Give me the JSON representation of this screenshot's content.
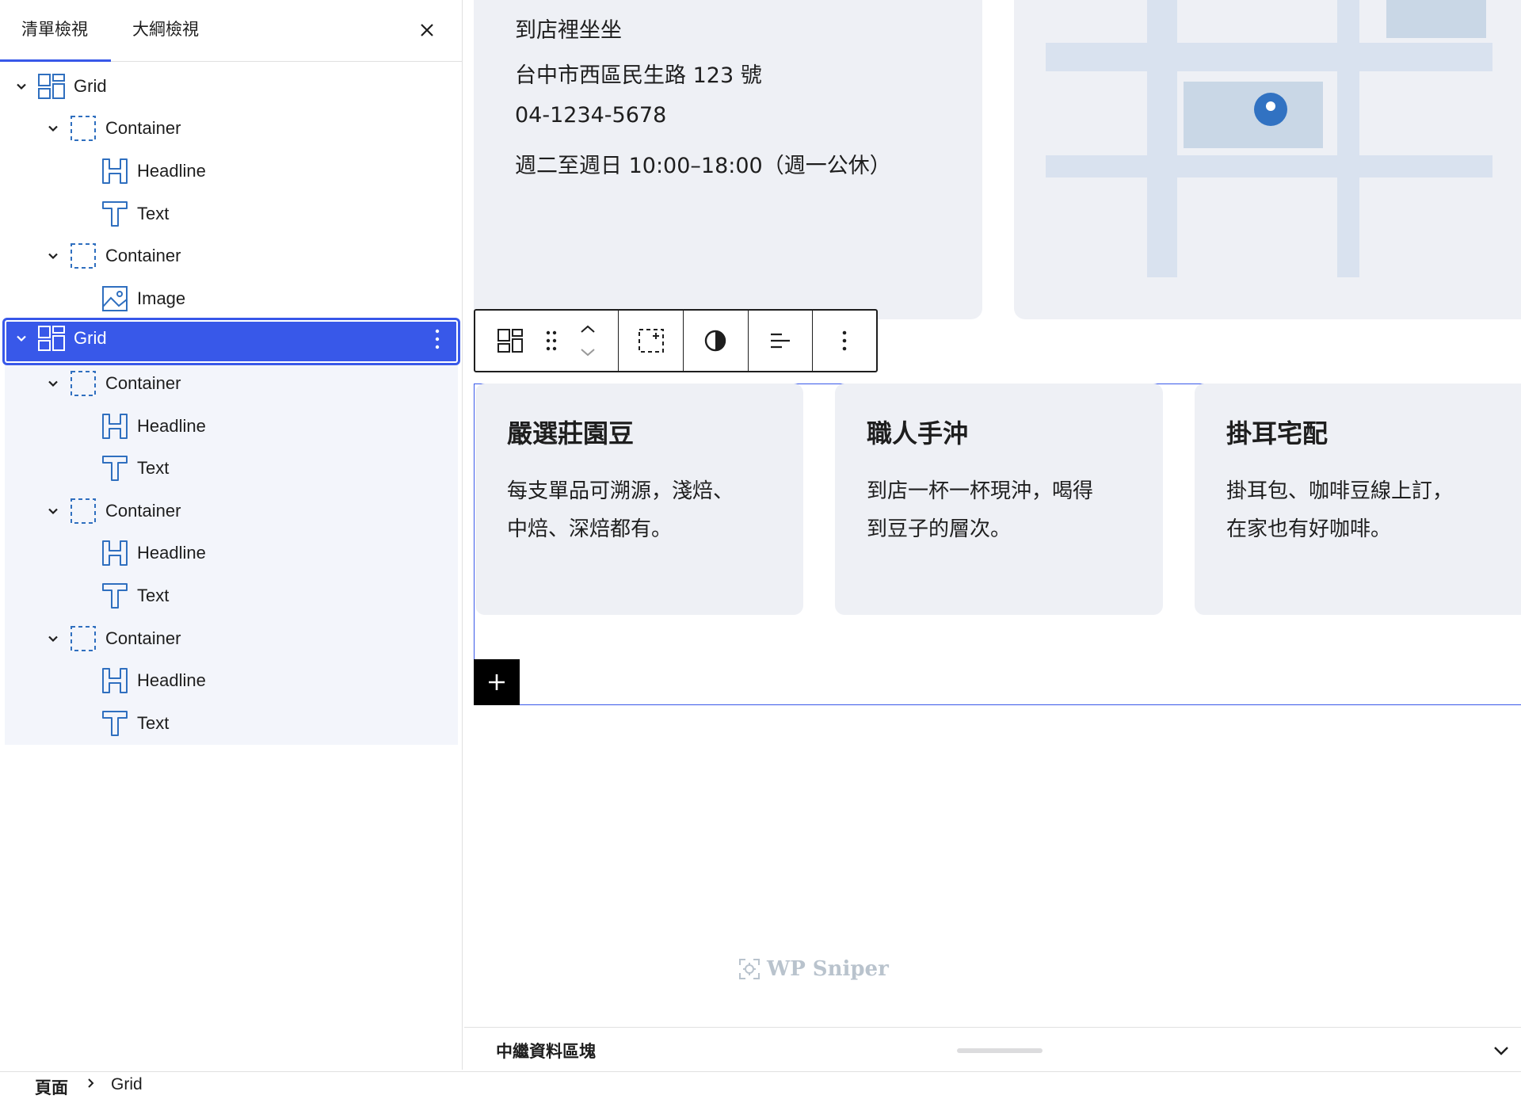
{
  "sidebar": {
    "tabs": [
      {
        "label": "清單檢視"
      },
      {
        "label": "大綱檢視"
      }
    ],
    "tree": [
      {
        "label": "Grid",
        "type": "grid",
        "level": 0
      },
      {
        "label": "Container",
        "type": "container",
        "level": 1
      },
      {
        "label": "Headline",
        "type": "headline",
        "level": 2
      },
      {
        "label": "Text",
        "type": "text",
        "level": 2
      },
      {
        "label": "Container",
        "type": "container",
        "level": 1
      },
      {
        "label": "Image",
        "type": "image",
        "level": 2
      },
      {
        "label": "Grid",
        "type": "grid",
        "level": 0,
        "selected": true
      },
      {
        "label": "Container",
        "type": "container",
        "level": 1
      },
      {
        "label": "Headline",
        "type": "headline",
        "level": 2
      },
      {
        "label": "Text",
        "type": "text",
        "level": 2
      },
      {
        "label": "Container",
        "type": "container",
        "level": 1
      },
      {
        "label": "Headline",
        "type": "headline",
        "level": 2
      },
      {
        "label": "Text",
        "type": "text",
        "level": 2
      },
      {
        "label": "Container",
        "type": "container",
        "level": 1
      },
      {
        "label": "Headline",
        "type": "headline",
        "level": 2
      },
      {
        "label": "Text",
        "type": "text",
        "level": 2
      }
    ]
  },
  "canvas": {
    "info": {
      "lines": [
        "到店裡坐坐",
        "台中市西區民生路 123 號",
        "04-1234-5678",
        "週二至週日 10:00–18:00（週一公休）"
      ]
    },
    "features": [
      {
        "title": "嚴選莊園豆",
        "text_1": "每支單品可溯源，淺焙、",
        "text_2": "中焙、深焙都有。"
      },
      {
        "title": "職人手沖",
        "text_1": "到店一杯一杯現沖，喝得",
        "text_2": "到豆子的層次。"
      },
      {
        "title": "掛耳宅配",
        "text_1": "掛耳包、咖啡豆線上訂，",
        "text_2": "在家也有好咖啡。"
      }
    ],
    "watermark": "WP Sniper"
  },
  "meta_box": {
    "title": "中繼資料區塊"
  },
  "breadcrumb": {
    "items": [
      "頁面",
      "Grid"
    ]
  },
  "colors": {
    "accent": "#3858e9",
    "icon_blue": "#2f6fbf",
    "card_bg": "#eef0f5",
    "map_road": "#d9e2ef",
    "map_block": "#c9d7e6",
    "pin": "#3172c2"
  },
  "icons": {
    "close": "close-icon",
    "chevron": "chevron-down-icon",
    "more": "more-vertical-icon"
  }
}
